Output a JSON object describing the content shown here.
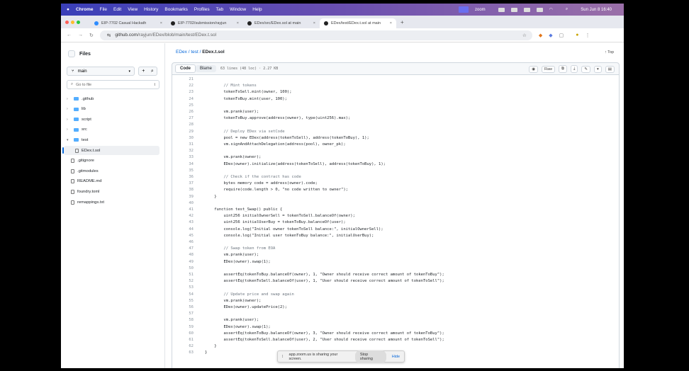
{
  "menubar": {
    "app": "Chrome",
    "items": [
      "File",
      "Edit",
      "View",
      "History",
      "Bookmarks",
      "Profiles",
      "Tab",
      "Window",
      "Help"
    ],
    "zoom": "zoom",
    "datetime": "Sun Jun 8  16:40"
  },
  "tabs": [
    {
      "label": "EIP-7702 Casual Hackath",
      "icon": "zoom-icon"
    },
    {
      "label": "EIP-7702/submission/rayjun",
      "icon": "github-icon"
    },
    {
      "label": "EDex/src/EDex.sol at main",
      "icon": "github-icon"
    },
    {
      "label": "EDex/test/EDex.t.sol at main",
      "icon": "github-icon"
    }
  ],
  "address": {
    "host": "github.com",
    "path": "/rayjun/EDex/blob/main/test/EDex.t.sol"
  },
  "sidebar": {
    "title": "Files",
    "branch": "main",
    "goto_placeholder": "Go to file",
    "goto_shortcut": "t",
    "items": [
      {
        "label": ".github",
        "type": "folder"
      },
      {
        "label": "lib",
        "type": "folder"
      },
      {
        "label": "script",
        "type": "folder"
      },
      {
        "label": "src",
        "type": "folder"
      },
      {
        "label": "test",
        "type": "folder-open"
      },
      {
        "label": "EDex.t.sol",
        "type": "file",
        "selected": true
      },
      {
        "label": ".gitignore",
        "type": "file"
      },
      {
        "label": ".gitmodules",
        "type": "file"
      },
      {
        "label": "README.md",
        "type": "file"
      },
      {
        "label": "foundry.toml",
        "type": "file"
      },
      {
        "label": "remappings.txt",
        "type": "file"
      }
    ]
  },
  "breadcrumb": {
    "repo": "EDex",
    "folder": "test",
    "file": "EDex.t.sol"
  },
  "top_link": "↑ Top",
  "code_header": {
    "code_tab": "Code",
    "blame_tab": "Blame",
    "meta": "63 lines (48 loc) · 2.27 KB",
    "raw": "Raw"
  },
  "code": {
    "start": 21,
    "lines": [
      "",
      "        // Mint tokens",
      "        tokenToSell.mint(owner, 100);",
      "        tokenToBuy.mint(user, 100);",
      "",
      "        vm.prank(user);",
      "        tokenToBuy.approve(address(owner), type(uint256).max);",
      "",
      "        // Deploy EDex via setCode",
      "        pool = new EDex(address(tokenToSell), address(tokenToBuy), 1);",
      "        vm.signAndAttachDelegation(address(pool), owner_pk);",
      "",
      "        vm.prank(owner);",
      "        EDex(owner).initialize(address(tokenToSell), address(tokenToBuy), 1);",
      "",
      "        // Check if the contract has code",
      "        bytes memory code = address(owner).code;",
      "        require(code.length > 0, \"no code written to owner\");",
      "    }",
      "",
      "    function test_Swap() public {",
      "        uint256 initialOwnerSell = tokenToSell.balanceOf(owner);",
      "        uint256 initialUserBuy = tokenToBuy.balanceOf(user);",
      "        console.log(\"Initial owner tokenToSell balance:\", initialOwnerSell);",
      "        console.log(\"Initial user tokenToBuy balance:\", initialUserBuy);",
      "",
      "        // Swap token from EOA",
      "        vm.prank(user);",
      "        EDex(owner).swap(1);",
      "",
      "        assertEq(tokenToBuy.balanceOf(owner), 1, \"Owner should receive correct amount of tokenToBuy\");",
      "        assertEq(tokenToSell.balanceOf(user), 1, \"User should receive correct amount of tokenToSell\");",
      "",
      "        // Update price and swap again",
      "        vm.prank(owner);",
      "        EDex(owner).updatePrice(2);",
      "",
      "        vm.prank(user);",
      "        EDex(owner).swap(1);",
      "        assertEq(tokenToBuy.balanceOf(owner), 3, \"Owner should receive correct amount of tokenToBuy\");",
      "        assertEq(tokenToSell.balanceOf(user), 2, \"User should receive correct amount of tokenToSell\");",
      "    }",
      "}"
    ]
  },
  "share_bar": {
    "message": "app.zoom.us is sharing your screen.",
    "stop": "Stop sharing",
    "hide": "Hide"
  }
}
